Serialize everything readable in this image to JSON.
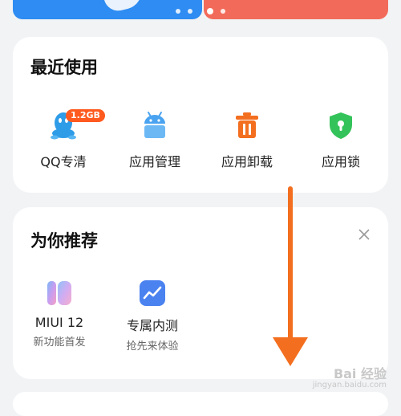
{
  "banner": {
    "page_dots": 4,
    "active_dot": 2
  },
  "recent": {
    "title": "最近使用",
    "apps": [
      {
        "label": "QQ专清",
        "icon": "qq-penguin-icon",
        "badge": "1.2GB"
      },
      {
        "label": "应用管理",
        "icon": "android-icon"
      },
      {
        "label": "应用卸载",
        "icon": "trash-icon"
      },
      {
        "label": "应用锁",
        "icon": "shield-lock-icon"
      }
    ]
  },
  "recommend": {
    "title": "为你推荐",
    "items": [
      {
        "label": "MIUI 12",
        "sub": "新功能首发",
        "icon": "miui-12-icon"
      },
      {
        "label": "专属内测",
        "sub": "抢先来体验",
        "icon": "trend-chart-icon"
      }
    ]
  },
  "watermark": {
    "text": "Bai 经验",
    "sub": "jingyan.baidu.com"
  },
  "colors": {
    "banner_left": "#2e8cf2",
    "banner_right": "#f26b5a",
    "badge": "#ff5a1f",
    "arrow": "#f36f1f",
    "trash": "#f36f1f",
    "shield": "#34c35a",
    "android": "#4aa3f0",
    "qq": "#2f9ce8"
  }
}
